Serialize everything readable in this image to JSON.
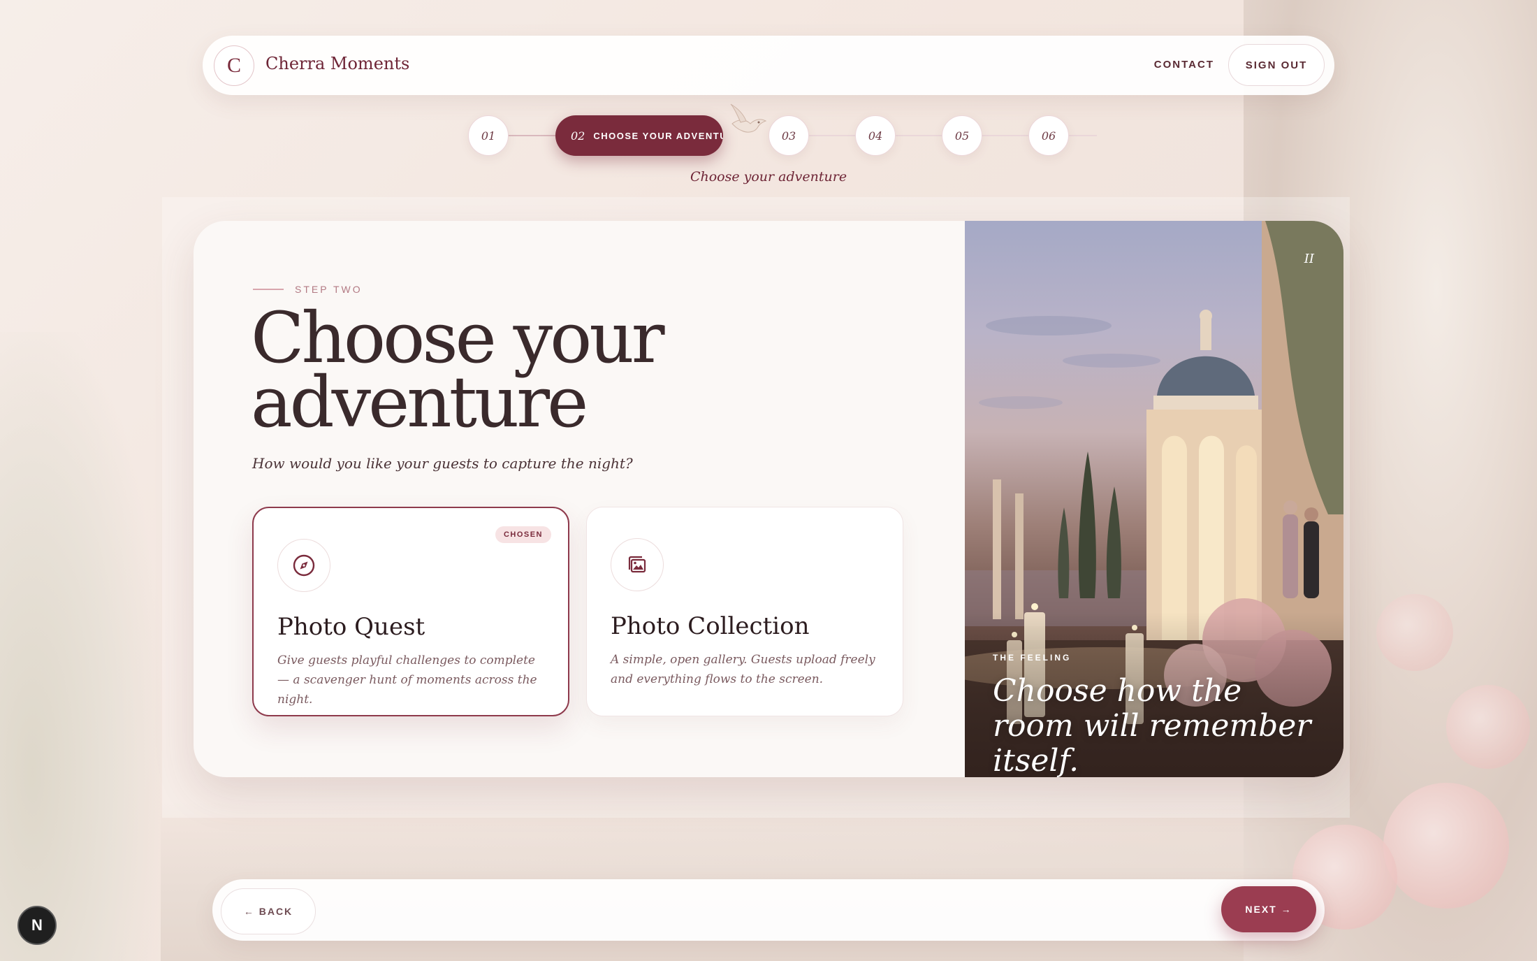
{
  "brand": {
    "initial": "C",
    "name": "Cherra Moments"
  },
  "header": {
    "contact_label": "CONTACT",
    "signout_label": "SIGN OUT"
  },
  "stepper": {
    "steps": [
      "01",
      "02",
      "03",
      "04",
      "05",
      "06"
    ],
    "active_label": "CHOOSE YOUR ADVENTU",
    "caption": "Choose your adventure"
  },
  "main": {
    "eyebrow": "STEP TWO",
    "title_line1": "Choose your",
    "title_line2": "adventure",
    "subtitle": "How would you like your guests to capture the night?",
    "options": [
      {
        "title": "Photo Quest",
        "badge": "CHOSEN",
        "icon": "compass-icon",
        "description": "Give guests playful challenges to complete — a scavenger hunt of moments across the night."
      },
      {
        "title": "Photo Collection",
        "icon": "gallery-icon",
        "description": "A simple, open gallery. Guests upload freely and everything flows to the screen."
      }
    ]
  },
  "feature": {
    "numeral": "II",
    "label": "THE FEELING",
    "quote": "Choose how the room will remember itself."
  },
  "footer": {
    "back_label": "← BACK",
    "next_label": "NEXT →"
  },
  "devtools": {
    "badge_letter": "N"
  },
  "colors": {
    "accent": "#7a2b3c",
    "next_button": "#9b3d51",
    "background": "#f3e6df"
  }
}
